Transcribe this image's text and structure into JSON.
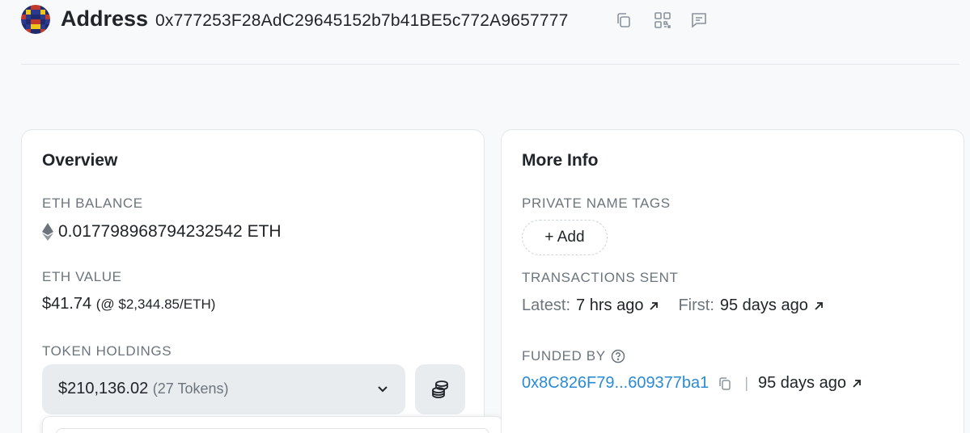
{
  "header": {
    "title": "Address",
    "address": "0x777253F28AdC29645152b7b41BE5c772A9657777",
    "icons": [
      "copy-icon",
      "qr-code-icon",
      "comment-icon"
    ]
  },
  "overview": {
    "title": "Overview",
    "eth_balance_label": "ETH BALANCE",
    "eth_balance": "0.017798968794232542 ETH",
    "eth_value_label": "ETH VALUE",
    "eth_value": "$41.74",
    "eth_rate": "(@ $2,344.85/ETH)",
    "token_holdings_label": "TOKEN HOLDINGS",
    "token_amount": "$210,136.02",
    "token_count": "(27 Tokens)"
  },
  "more_info": {
    "title": "More Info",
    "private_tags_label": "PRIVATE NAME TAGS",
    "add_label": "+ Add",
    "tx_sent_label": "TRANSACTIONS SENT",
    "latest_label": "Latest:",
    "latest_value": "7 hrs ago",
    "first_label": "First:",
    "first_value": "95 days ago",
    "funded_by_label": "FUNDED BY",
    "funded_by_address": "0x8C826F79...609377ba1",
    "funded_sep": "|",
    "funded_age": "95 days ago"
  },
  "colors": {
    "link": "#2a8bd4",
    "muted": "#6c757d",
    "text": "#212529",
    "card_border": "#e3e6ea",
    "select_bg": "#e9ecef"
  }
}
